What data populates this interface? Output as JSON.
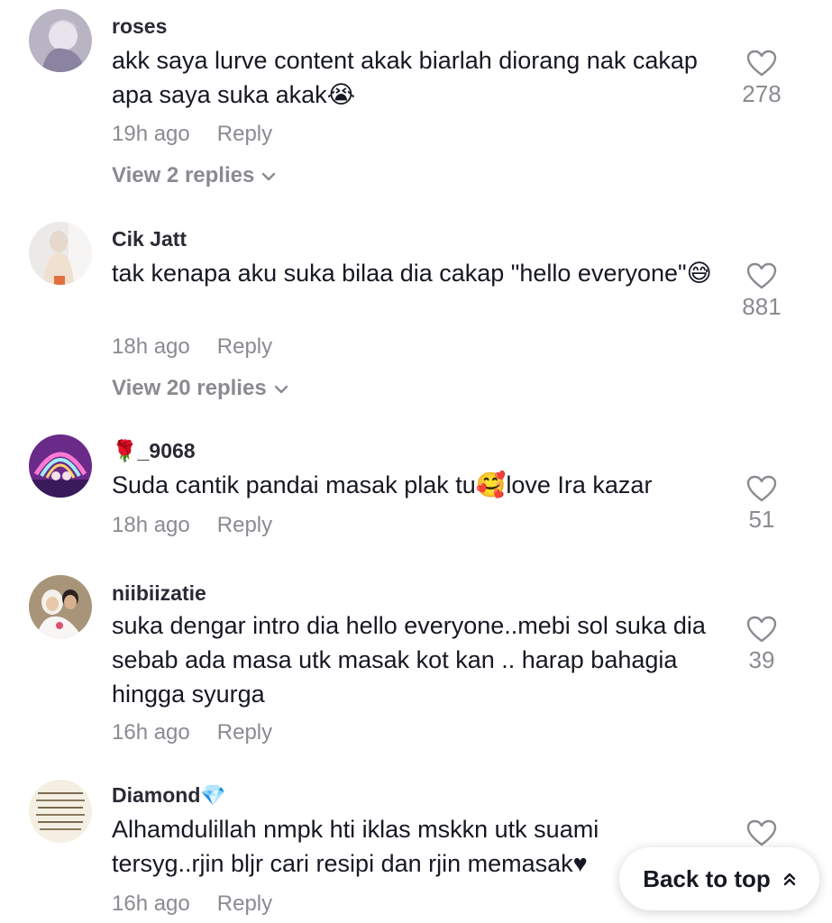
{
  "comments": [
    {
      "username": "roses",
      "text": "akk saya lurve content akak biarlah diorang nak cakap apa saya suka akak😭",
      "time": "19h ago",
      "reply_label": "Reply",
      "likes": "278",
      "view_replies": "View 2 replies"
    },
    {
      "username": "Cik Jatt",
      "text": "tak kenapa aku suka bilaa dia cakap \"hello everyone\"😅",
      "time": "18h ago",
      "reply_label": "Reply",
      "likes": "881",
      "view_replies": "View 20 replies"
    },
    {
      "username": "🌹_9068",
      "text": "Suda cantik pandai masak plak tu🥰love Ira kazar",
      "time": "18h ago",
      "reply_label": "Reply",
      "likes": "51"
    },
    {
      "username": "niibiizatie",
      "text": "suka dengar intro dia hello everyone..mebi sol suka dia sebab ada masa utk masak kot kan .. harap bahagia hingga syurga",
      "time": "16h ago",
      "reply_label": "Reply",
      "likes": "39"
    },
    {
      "username": "Diamond💎",
      "text": "Alhamdulillah nmpk hti iklas mskkn utk suami tersyg..rjin bljr cari resipi dan rjin memasak♥",
      "time": "16h ago",
      "reply_label": "Reply",
      "likes": ""
    }
  ],
  "back_to_top": {
    "label": "Back to top",
    "icon": "double-chevron-up-icon"
  },
  "icons": {
    "like": "heart-outline-icon",
    "expand": "chevron-down-icon"
  },
  "colors": {
    "text": "#161823",
    "secondary": "#8a8b91"
  }
}
